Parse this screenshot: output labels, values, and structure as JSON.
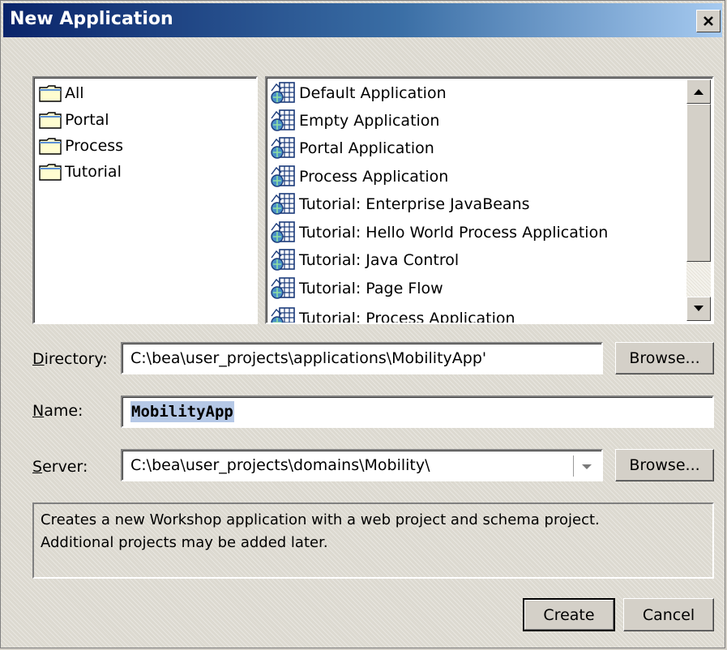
{
  "window": {
    "title": "New Application"
  },
  "categories": [
    {
      "label": "All"
    },
    {
      "label": "Portal"
    },
    {
      "label": "Process"
    },
    {
      "label": "Tutorial"
    }
  ],
  "templates": [
    {
      "label": "Default Application"
    },
    {
      "label": "Empty Application"
    },
    {
      "label": "Portal Application"
    },
    {
      "label": "Process Application"
    },
    {
      "label": "Tutorial: Enterprise JavaBeans"
    },
    {
      "label": "Tutorial: Hello World Process Application"
    },
    {
      "label": "Tutorial: Java Control"
    },
    {
      "label": "Tutorial: Page Flow"
    },
    {
      "label": "Tutorial: Process Application"
    }
  ],
  "form": {
    "directory_label_key": "D",
    "directory_label_rest": "irectory:",
    "directory_value": "C:\\bea\\user_projects\\applications\\MobilityApp'",
    "name_label_key": "N",
    "name_label_rest": "ame:",
    "name_value": "MobilityApp",
    "server_label_key": "S",
    "server_label_rest": "erver:",
    "server_value": "C:\\bea\\user_projects\\domains\\Mobility\\",
    "browse_label": "Browse..."
  },
  "description": {
    "line1": "Creates a new Workshop application with a web project and schema project.",
    "line2": "Additional projects may be added later."
  },
  "buttons": {
    "create": "Create",
    "cancel": "Cancel"
  },
  "icons": {
    "folder": "folder-icon",
    "application": "application-icon",
    "close": "close-icon",
    "scroll_up": "arrow-up-icon",
    "scroll_down": "arrow-down-icon",
    "dropdown": "chevron-down-icon"
  },
  "colors": {
    "title_start": "#0a246a",
    "title_end": "#a6caf0",
    "selection": "#b5c8e6",
    "dialog_bg": "#d4d0c8"
  }
}
